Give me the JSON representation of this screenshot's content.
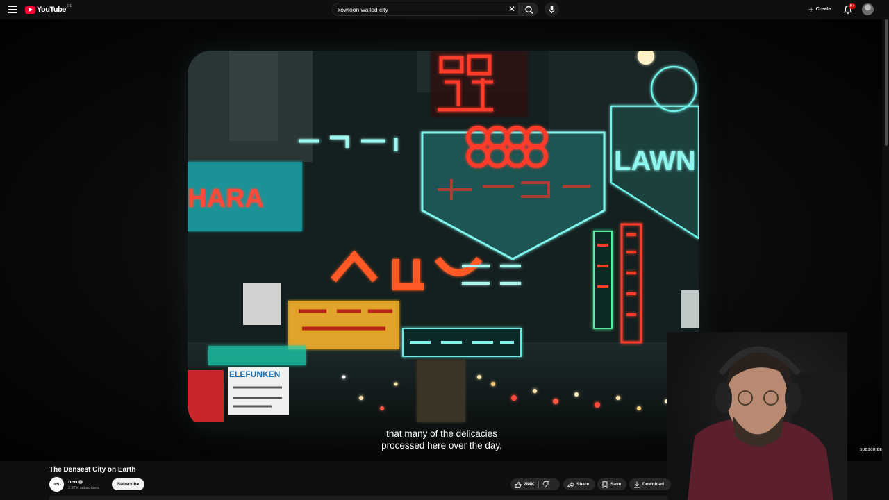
{
  "header": {
    "logo_text": "YouTube",
    "region": "DE",
    "search_value": "kowloon walled city",
    "create_label": "Create",
    "notification_count": "9+"
  },
  "player": {
    "subtitle_lines": [
      "that many of the delicacies",
      "processed here over the day,"
    ],
    "frame_signs": {
      "hara": "HARA",
      "lawn": "LAWN",
      "telefunken": "ELEFUNKEN"
    },
    "subscribe_watermark": "SUBSCRIBE"
  },
  "video": {
    "title": "The Densest City on Earth",
    "channel_avatar_text": "neo",
    "channel_name": "neo",
    "subscribers": "2.97M subscribers",
    "subscribe_label": "Subscribe"
  },
  "actions": {
    "likes": "284K",
    "share_label": "Share",
    "save_label": "Save",
    "download_label": "Download"
  },
  "colors": {
    "brand_red": "#ff0033",
    "background": "#0f0f0f",
    "neon_red": "#ff3a2a",
    "neon_teal": "#3fe0d6"
  }
}
